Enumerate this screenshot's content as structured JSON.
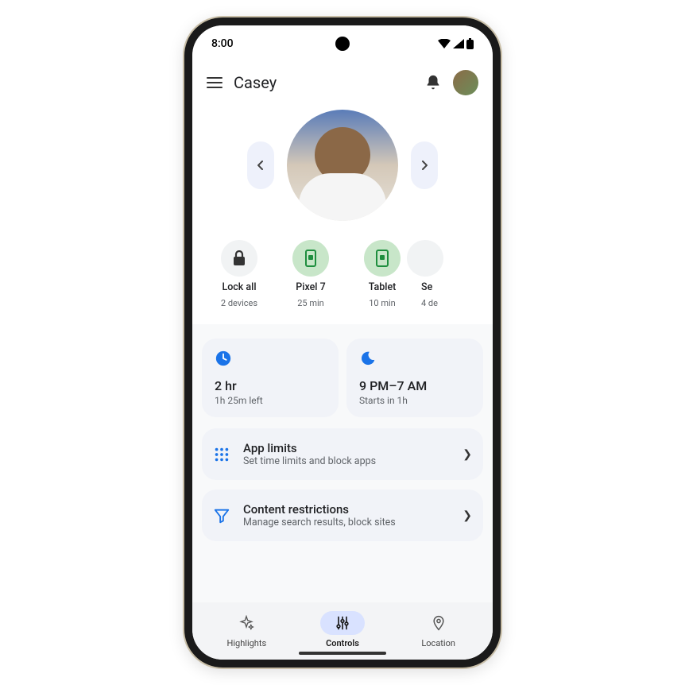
{
  "statusbar": {
    "time": "8:00"
  },
  "header": {
    "title": "Casey"
  },
  "devices": [
    {
      "label": "Lock all",
      "sub": "2 devices"
    },
    {
      "label": "Pixel 7",
      "sub": "25 min"
    },
    {
      "label": "Tablet",
      "sub": "10 min"
    },
    {
      "label": "Se",
      "sub": "4 de"
    }
  ],
  "stats": {
    "screentime": {
      "value": "2 hr",
      "sub": "1h 25m left"
    },
    "downtime": {
      "value": "9 PM–7 AM",
      "sub": "Starts in 1h"
    }
  },
  "actions": {
    "applimits": {
      "title": "App limits",
      "sub": "Set time limits and block apps"
    },
    "content": {
      "title": "Content restrictions",
      "sub": "Manage search results, block sites"
    }
  },
  "nav": {
    "highlights": "Highlights",
    "controls": "Controls",
    "location": "Location"
  }
}
